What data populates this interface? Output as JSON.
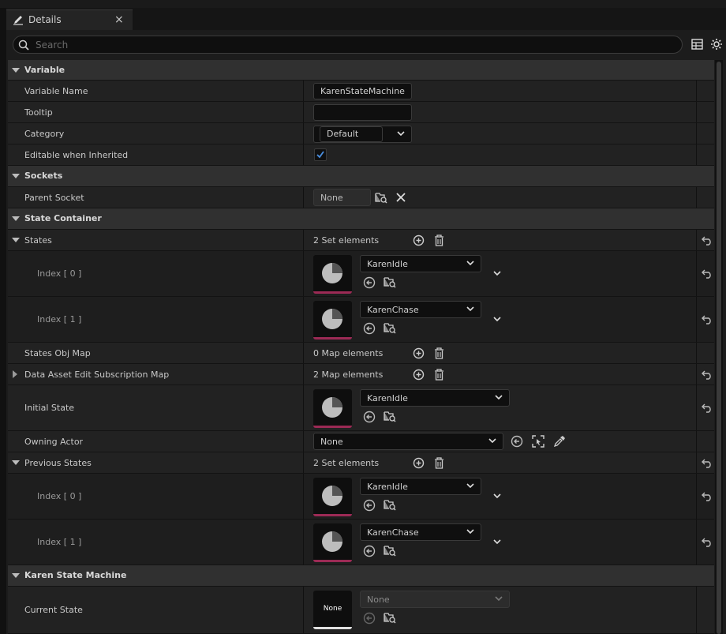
{
  "tab": {
    "title": "Details",
    "close": "×"
  },
  "search": {
    "placeholder": "Search"
  },
  "variable": {
    "category_label": "Variable",
    "name_label": "Variable Name",
    "name_value": "KarenStateMachine",
    "tooltip_label": "Tooltip",
    "tooltip_value": "",
    "category_field_label": "Category",
    "category_value": "Default",
    "editable_label": "Editable when Inherited",
    "editable_checked": true
  },
  "sockets": {
    "category_label": "Sockets",
    "parent_label": "Parent Socket",
    "parent_value": "None"
  },
  "state_container": {
    "category_label": "State Container",
    "states_label": "States",
    "states_count": "2 Set elements",
    "states": [
      {
        "index": "Index [ 0 ]",
        "value": "KarenIdle"
      },
      {
        "index": "Index [ 1 ]",
        "value": "KarenChase"
      }
    ],
    "obj_map_label": "States Obj Map",
    "obj_map_count": "0 Map elements",
    "subscription_label": "Data Asset Edit Subscription Map",
    "subscription_count": "2 Map elements",
    "initial_label": "Initial State",
    "initial_value": "KarenIdle",
    "owning_label": "Owning Actor",
    "owning_value": "None",
    "previous_label": "Previous States",
    "previous_count": "2 Set elements",
    "previous": [
      {
        "index": "Index [ 0 ]",
        "value": "KarenIdle"
      },
      {
        "index": "Index [ 1 ]",
        "value": "KarenChase"
      }
    ]
  },
  "karen_state_machine": {
    "category_label": "Karen State Machine",
    "current_label": "Current State",
    "current_value": "None",
    "current_thumb": "None"
  },
  "colors": {
    "accent_underline": "#9c2a55",
    "check": "#4a90e2",
    "panel": "#1c1c1c"
  },
  "icons": [
    "pencil-icon",
    "search-icon",
    "table-icon",
    "gear-icon",
    "plus-circle-icon",
    "trash-icon",
    "reset-arrow-icon",
    "browse-icon",
    "use-selected-icon",
    "clear-icon",
    "chevron-down-icon",
    "picker-icon",
    "select-actor-icon"
  ]
}
